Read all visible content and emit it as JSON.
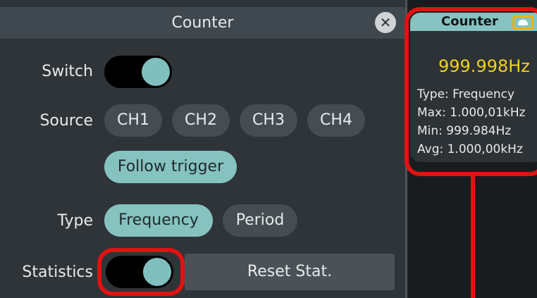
{
  "panel": {
    "title": "Counter",
    "close_icon": "close-icon",
    "switch_label": "Switch",
    "switch_state": "on",
    "source_label": "Source",
    "sources": [
      "CH1",
      "CH2",
      "CH3",
      "CH4"
    ],
    "follow_trigger_label": "Follow trigger",
    "follow_trigger_selected": true,
    "type_label": "Type",
    "types": [
      "Frequency",
      "Period"
    ],
    "type_selected": "Frequency",
    "statistics_label": "Statistics",
    "statistics_state": "on",
    "reset_label": "Reset Stat."
  },
  "readout": {
    "title": "Counter",
    "icon": "cloud-icon",
    "value": "999.998Hz",
    "type_line": "Type: Frequency",
    "max_line": "Max: 1.000,01kHz",
    "min_line": "Min: 999.984Hz",
    "avg_line": "Avg: 1.000,00kHz"
  },
  "colors": {
    "accent": "#86c3c0",
    "highlight": "#e11212",
    "value": "#f2d11a"
  }
}
